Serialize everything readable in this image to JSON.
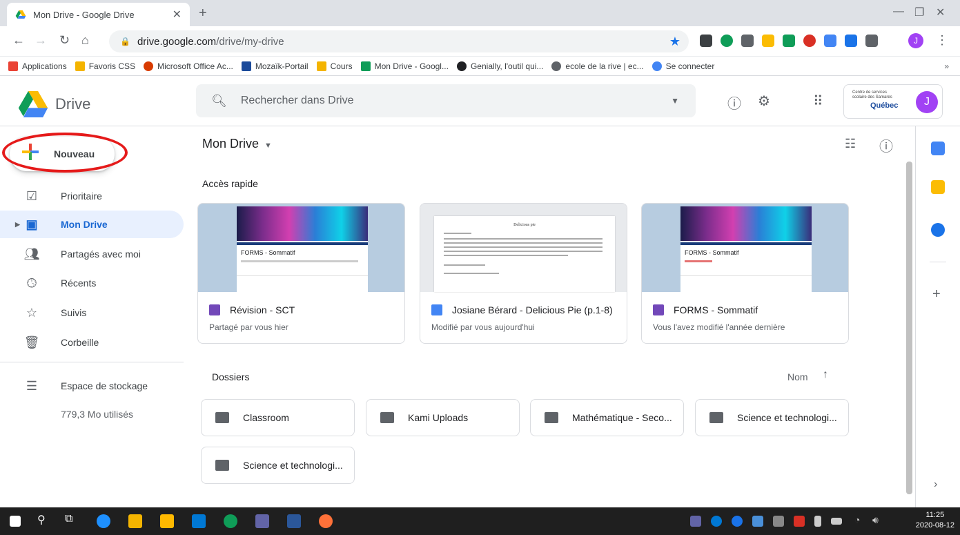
{
  "browser": {
    "tab_title": "Mon Drive - Google Drive",
    "url_host": "drive.google.com",
    "url_path": "/drive/my-drive",
    "profile_initial": "J"
  },
  "bookmarks": [
    {
      "label": "Applications",
      "icon": "apps-grid-icon",
      "color": "#ea4335"
    },
    {
      "label": "Favoris CSS",
      "icon": "folder-icon",
      "color": "#f4b400"
    },
    {
      "label": "Microsoft Office Ac...",
      "icon": "office-icon",
      "color": "#d83b01"
    },
    {
      "label": "Mozaïk-Portail",
      "icon": "mp-icon",
      "color": "#1a4a9a"
    },
    {
      "label": "Cours",
      "icon": "classroom-icon",
      "color": "#f4b400"
    },
    {
      "label": "Mon Drive - Googl...",
      "icon": "drive-icon",
      "color": "#0f9d58"
    },
    {
      "label": "Genially, l'outil qui...",
      "icon": "genially-icon",
      "color": "#202124"
    },
    {
      "label": "ecole de la rive | ec...",
      "icon": "globe-icon",
      "color": "#5f6368"
    },
    {
      "label": "Se connecter",
      "icon": "login-icon",
      "color": "#4285f4"
    }
  ],
  "header": {
    "app_name": "Drive",
    "search_placeholder": "Rechercher dans Drive",
    "org_text": "Centre de services scolaire des Samares",
    "org_quebec": "Québec",
    "avatar_initial": "J"
  },
  "sidebar": {
    "new_label": "Nouveau",
    "items": [
      {
        "label": "Prioritaire",
        "icon": "priority-check-icon"
      },
      {
        "label": "Mon Drive",
        "icon": "my-drive-icon",
        "active": true
      },
      {
        "label": "Partagés avec moi",
        "icon": "shared-people-icon"
      },
      {
        "label": "Récents",
        "icon": "clock-icon"
      },
      {
        "label": "Suivis",
        "icon": "star-icon"
      },
      {
        "label": "Corbeille",
        "icon": "trash-icon"
      }
    ],
    "storage_label": "Espace de stockage",
    "storage_used": "779,3 Mo utilisés"
  },
  "main": {
    "title": "Mon Drive",
    "quick_access_label": "Accès rapide",
    "cards": [
      {
        "name": "Révision - SCT",
        "meta": "Partagé par vous hier",
        "type": "form",
        "thumb_title": "FORMS - Sommatif"
      },
      {
        "name": "Josiane Bérard - Delicious Pie (p.1-8)",
        "meta": "Modifié par vous aujourd'hui",
        "type": "doc",
        "thumb_title": "Delicious pie"
      },
      {
        "name": "FORMS - Sommatif",
        "meta": "Vous l'avez modifié l'année dernière",
        "type": "form",
        "thumb_title": "FORMS - Sommatif"
      }
    ],
    "folders_label": "Dossiers",
    "sort_label": "Nom",
    "folders": [
      {
        "name": "Classroom"
      },
      {
        "name": "Kami Uploads"
      },
      {
        "name": "Mathématique - Seco..."
      },
      {
        "name": "Science et technologi..."
      },
      {
        "name": "Science et technologi..."
      }
    ]
  },
  "taskbar": {
    "time": "11:25",
    "date": "2020-08-12"
  }
}
